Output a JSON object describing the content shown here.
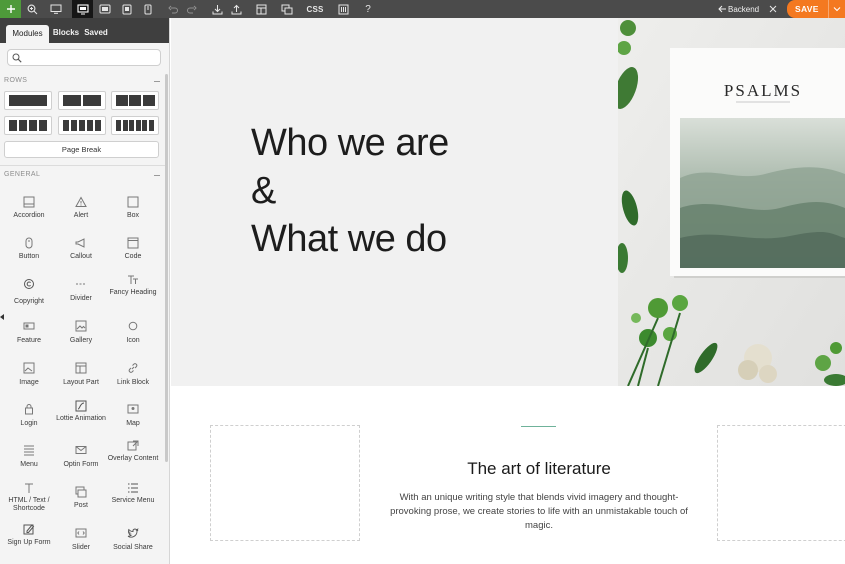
{
  "toolbar": {
    "backend_label": "Backend",
    "css_label": "CSS",
    "save_label": "SAVE",
    "help_label": "?",
    "accent_color": "#4e9a3a",
    "save_color": "#f47920",
    "icons": [
      "plus-icon",
      "zoom-icon",
      "preview-icon",
      "desktop-icon",
      "tablet-landscape-icon",
      "tablet-icon",
      "mobile-icon",
      "undo-icon",
      "redo-icon",
      "import-icon",
      "export-icon",
      "layouts-icon",
      "duplicate-icon",
      "css-icon",
      "columns-icon",
      "help-icon",
      "arrow-left-icon",
      "close-icon",
      "chevron-down-icon"
    ]
  },
  "panel": {
    "tabs": [
      {
        "label": "Modules"
      },
      {
        "label": "Blocks"
      },
      {
        "label": "Saved"
      }
    ],
    "search": {
      "placeholder": "",
      "value": ""
    },
    "rows_title": "ROWS",
    "page_break_label": "Page Break",
    "general_title": "GENERAL",
    "modules": [
      {
        "label": "Accordion",
        "icon": "accordion-icon"
      },
      {
        "label": "Alert",
        "icon": "alert-icon"
      },
      {
        "label": "Box",
        "icon": "box-icon"
      },
      {
        "label": "Button",
        "icon": "button-icon"
      },
      {
        "label": "Callout",
        "icon": "callout-icon"
      },
      {
        "label": "Code",
        "icon": "code-icon"
      },
      {
        "label": "Copyright",
        "icon": "copyright-icon"
      },
      {
        "label": "Divider",
        "icon": "divider-icon"
      },
      {
        "label": "Fancy Heading",
        "icon": "fancy-heading-icon"
      },
      {
        "label": "Feature",
        "icon": "feature-icon"
      },
      {
        "label": "Gallery",
        "icon": "gallery-icon"
      },
      {
        "label": "Icon",
        "icon": "circle-icon"
      },
      {
        "label": "Image",
        "icon": "image-icon"
      },
      {
        "label": "Layout Part",
        "icon": "layout-part-icon"
      },
      {
        "label": "Link Block",
        "icon": "link-icon"
      },
      {
        "label": "Login",
        "icon": "lock-icon"
      },
      {
        "label": "Lottie Animation",
        "icon": "lottie-icon"
      },
      {
        "label": "Map",
        "icon": "map-icon"
      },
      {
        "label": "Menu",
        "icon": "menu-icon"
      },
      {
        "label": "Optin Form",
        "icon": "envelope-icon"
      },
      {
        "label": "Overlay Content",
        "icon": "overlay-icon"
      },
      {
        "label": "HTML / Text / Shortcode",
        "icon": "text-icon"
      },
      {
        "label": "Post",
        "icon": "post-icon"
      },
      {
        "label": "Service Menu",
        "icon": "list-icon"
      },
      {
        "label": "Sign Up Form",
        "icon": "signup-icon"
      },
      {
        "label": "Slider",
        "icon": "slider-icon"
      },
      {
        "label": "Social Share",
        "icon": "twitter-icon"
      }
    ]
  },
  "canvas": {
    "hero_lines": [
      "Who we are",
      "&",
      "What we do"
    ],
    "book_title": "PSALMS",
    "section_title": "The art of literature",
    "section_body": "With an unique writing style that blends vivid imagery and thought-provoking prose, we create stories to life with an unmistakable touch of magic.",
    "accent_color": "#6fb29a"
  }
}
